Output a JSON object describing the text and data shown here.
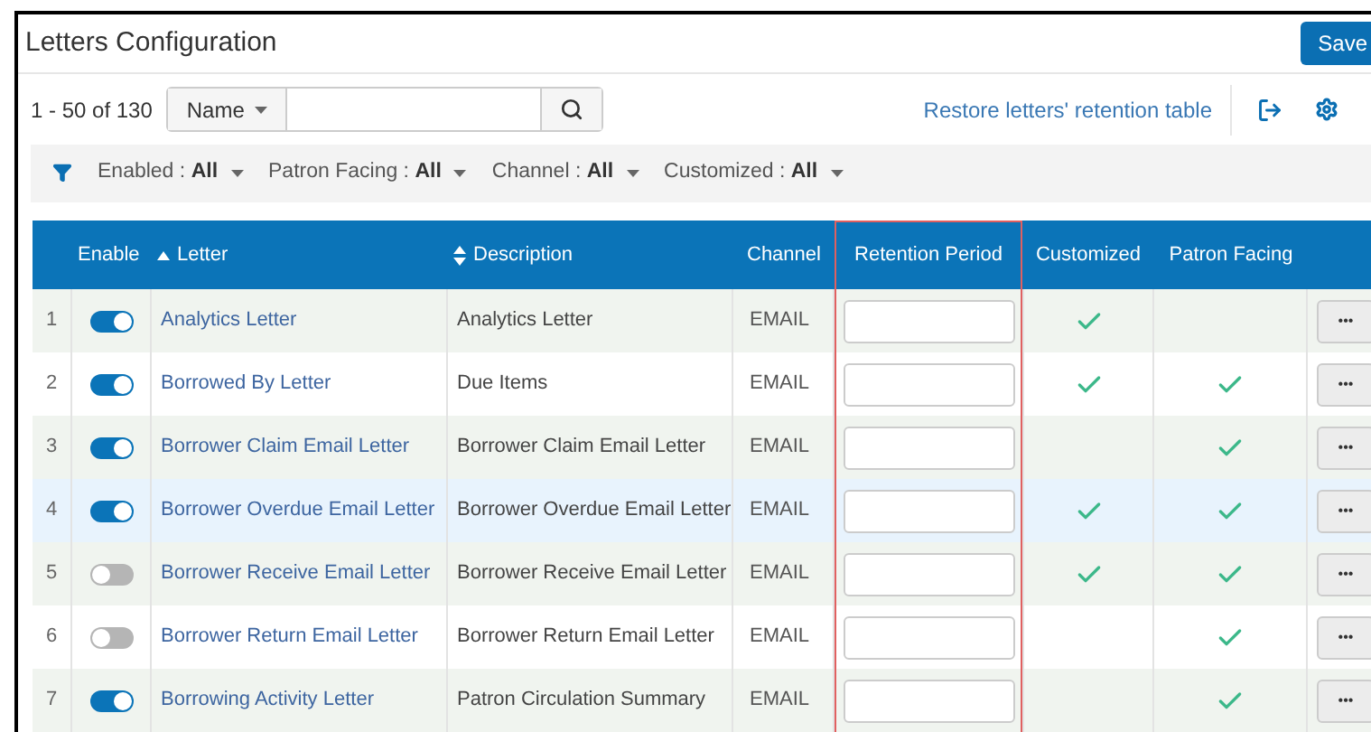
{
  "page": {
    "title": "Letters Configuration",
    "save_button": "Save"
  },
  "toolbar": {
    "count": "1 - 50 of 130",
    "search_scope": "Name",
    "restore_link": "Restore letters' retention table"
  },
  "filters": [
    {
      "label": "Enabled :",
      "value": "All"
    },
    {
      "label": "Patron Facing :",
      "value": "All"
    },
    {
      "label": "Channel :",
      "value": "All"
    },
    {
      "label": "Customized :",
      "value": "All"
    }
  ],
  "table": {
    "columns": [
      {
        "label": "Enable",
        "sorted": false,
        "sortable": false,
        "highlighted": false
      },
      {
        "label": "Letter",
        "sorted": true,
        "sortable": true,
        "highlighted": false
      },
      {
        "label": "Description",
        "sorted": false,
        "sortable": true,
        "highlighted": false
      },
      {
        "label": "Channel",
        "sorted": false,
        "sortable": false,
        "highlighted": false
      },
      {
        "label": "Retention Period",
        "sorted": false,
        "sortable": false,
        "highlighted": true
      },
      {
        "label": "Customized",
        "sorted": false,
        "sortable": false,
        "highlighted": false
      },
      {
        "label": "Patron Facing",
        "sorted": false,
        "sortable": false,
        "highlighted": false
      }
    ],
    "rows": [
      {
        "number": "1",
        "enabled": true,
        "letter": "Analytics Letter",
        "description": "Analytics Letter",
        "channel": "EMAIL",
        "customized": true,
        "patron_facing": false,
        "selected": false,
        "actions": "•••"
      },
      {
        "number": "2",
        "enabled": true,
        "letter": "Borrowed By Letter",
        "description": "Due Items",
        "channel": "EMAIL",
        "customized": true,
        "patron_facing": true,
        "selected": false,
        "actions": "•••"
      },
      {
        "number": "3",
        "enabled": true,
        "letter": "Borrower Claim Email Letter",
        "description": "Borrower Claim Email Letter",
        "channel": "EMAIL",
        "customized": false,
        "patron_facing": true,
        "selected": false,
        "actions": "•••"
      },
      {
        "number": "4",
        "enabled": true,
        "letter": "Borrower Overdue Email Letter",
        "description": "Borrower Overdue Email Letter",
        "channel": "EMAIL",
        "customized": true,
        "patron_facing": true,
        "selected": true,
        "actions": "•••"
      },
      {
        "number": "5",
        "enabled": false,
        "letter": "Borrower Receive Email Letter",
        "description": "Borrower Receive Email Letter",
        "channel": "EMAIL",
        "customized": true,
        "patron_facing": true,
        "selected": false,
        "actions": "•••"
      },
      {
        "number": "6",
        "enabled": false,
        "letter": "Borrower Return Email Letter",
        "description": "Borrower Return Email Letter",
        "channel": "EMAIL",
        "customized": false,
        "patron_facing": true,
        "selected": false,
        "actions": "•••"
      },
      {
        "number": "7",
        "enabled": true,
        "letter": "Borrowing Activity Letter",
        "description": "Patron Circulation Summary",
        "channel": "EMAIL",
        "customized": false,
        "patron_facing": true,
        "selected": false,
        "actions": "•••"
      }
    ]
  }
}
